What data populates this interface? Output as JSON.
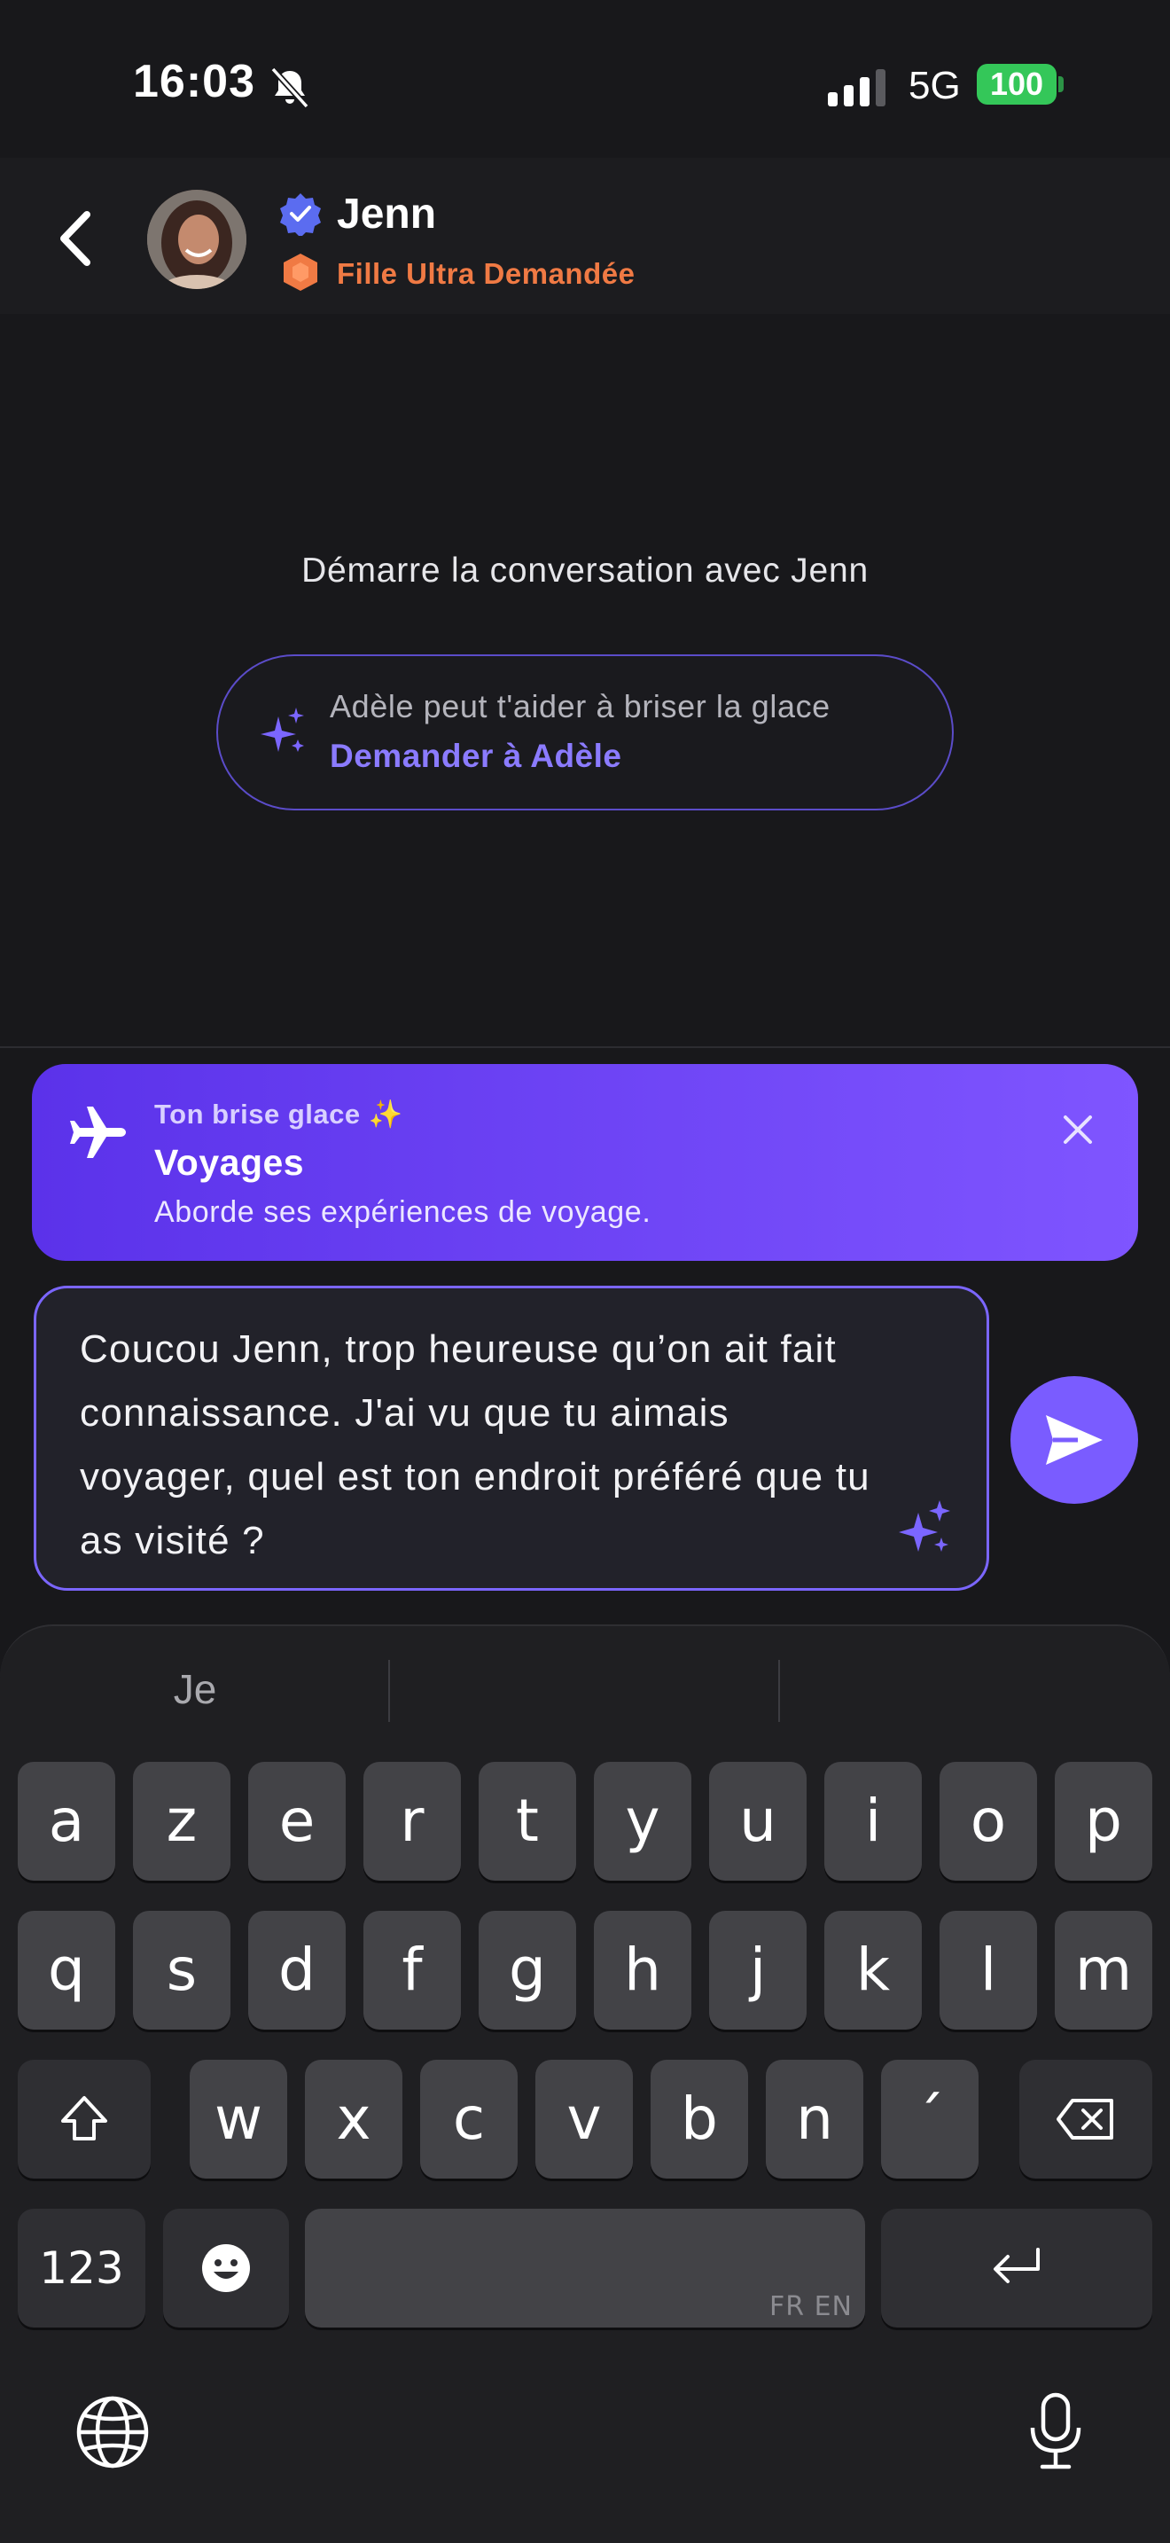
{
  "status_bar": {
    "time": "16:03",
    "network": "5G",
    "battery": "100"
  },
  "header": {
    "name": "Jenn",
    "badge": "Fille Ultra Demandée"
  },
  "conversation": {
    "start_text": "Démarre la conversation avec Jenn",
    "helper_text": "Adèle peut t'aider à briser la glace",
    "helper_link": "Demander à Adèle"
  },
  "icebreaker": {
    "kicker": "Ton brise glace ✨",
    "title": "Voyages",
    "description": "Aborde ses expériences de voyage."
  },
  "message": {
    "text": "Coucou Jenn, trop heureuse qu’on ait fait connaissance. J'ai vu que tu aimais voyager, quel est ton endroit préféré que tu as visité ?"
  },
  "keyboard": {
    "suggestions": [
      "Je",
      "",
      ""
    ],
    "row1": [
      "a",
      "z",
      "e",
      "r",
      "t",
      "y",
      "u",
      "i",
      "o",
      "p"
    ],
    "row2": [
      "q",
      "s",
      "d",
      "f",
      "g",
      "h",
      "j",
      "k",
      "l",
      "m"
    ],
    "row3": [
      "w",
      "x",
      "c",
      "v",
      "b",
      "n",
      "´"
    ],
    "numbers_label": "123",
    "space_hint": "FR EN"
  },
  "colors": {
    "accent": "#7a5cff",
    "badge": "#f07a44",
    "battery": "#34c759"
  }
}
